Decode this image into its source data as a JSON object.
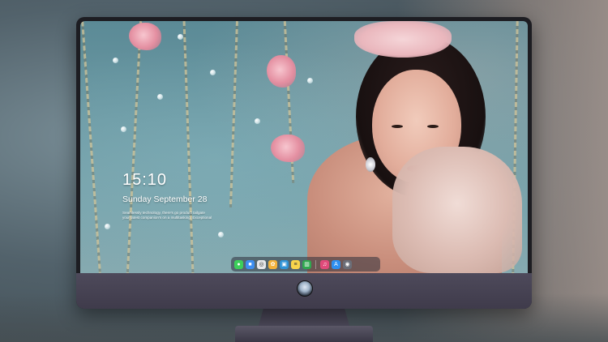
{
  "lockscreen": {
    "time": "15:10",
    "date": "Sunday September 28",
    "motto_lines": [
      "Seamlessly technology, there's go product tailgate",
      "your latest companion's on a multitasking. Exceptional"
    ]
  },
  "dock": {
    "apps": [
      {
        "name": "messages",
        "glyph": "●",
        "color": "#3ccf5a"
      },
      {
        "name": "finder",
        "glyph": "■",
        "color": "#3d8ef0"
      },
      {
        "name": "safari",
        "glyph": "◎",
        "color": "#e8e8ea"
      },
      {
        "name": "photos",
        "glyph": "✿",
        "color": "#f2b23c"
      },
      {
        "name": "clapper",
        "glyph": "▣",
        "color": "#2f93d6"
      },
      {
        "name": "notes",
        "glyph": "≡",
        "color": "#f7d44c"
      },
      {
        "name": "numbers",
        "glyph": "▥",
        "color": "#2fa84f"
      },
      {
        "name": "music",
        "glyph": "♫",
        "color": "#e04a7a"
      },
      {
        "name": "app-store",
        "glyph": "A",
        "color": "#2d8ff0"
      },
      {
        "name": "camera",
        "glyph": "◉",
        "color": "#6b6e78"
      }
    ]
  },
  "colors": {
    "monitor_chin": "#4e4a5b",
    "screen_tint": "#6d9aa4",
    "text": "#ffffff"
  }
}
